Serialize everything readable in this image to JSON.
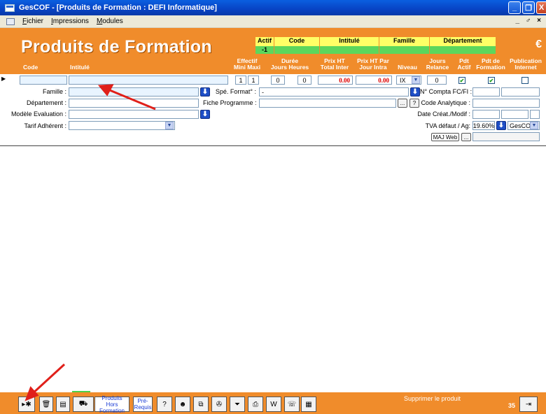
{
  "window": {
    "title": "GesCOF - [Produits de Formation  : DEFI Informatique]",
    "minimize": "_",
    "restore": "❐",
    "close": "X"
  },
  "menu": {
    "items": [
      "Fichier",
      "Impressions",
      "Modules"
    ],
    "mdi_controls": "_ ♂ ×"
  },
  "header": {
    "title": "Produits de Formation",
    "currency": "€",
    "filters": [
      {
        "label": "Actif",
        "value": "-1"
      },
      {
        "label": "Code",
        "value": ""
      },
      {
        "label": "Intitulé",
        "value": ""
      },
      {
        "label": "Famille",
        "value": ""
      },
      {
        "label": "Département",
        "value": ""
      }
    ],
    "columns": {
      "code": "Code",
      "intitule": "Intitulé",
      "effectif": "Effectif",
      "mini_maxi": "Mini Maxi",
      "duree": "Durée",
      "jours_heures": "Jours Heures",
      "prix_ht": "Prix HT",
      "total_inter": "Total Inter",
      "prix_ht_par": "Prix HT Par",
      "jour_intra": "Jour Intra",
      "niveau": "Niveau",
      "jours": "Jours",
      "relance": "Relance",
      "pdt": "Pdt",
      "actif": "Actif",
      "pdt_de": "Pdt de",
      "formation": "Formation",
      "publication": "Publication",
      "internet": "Internet"
    }
  },
  "row": {
    "code": "",
    "intitule": "",
    "mini": "1",
    "maxi": "1",
    "jours": "0",
    "heures": "0",
    "prix_inter": "0.00",
    "prix_intra": "0.00",
    "niveau": "IX",
    "relance": "0",
    "pdt_actif": "✔",
    "pdt_formation": "✔",
    "publication": ""
  },
  "form": {
    "famille_label": "Famille :",
    "departement_label": "Département :",
    "modele_label": "Modèle Evaluation :",
    "tarif_label": "Tarif Adhérent :",
    "spe_format_label": "Spé. Format° :",
    "spe_format_value": "-",
    "fiche_label": "Fiche Programme :",
    "compta_label": "N° Compta FC/FI :",
    "analytique_label": "Code Analytique :",
    "date_label": "Date Créat./Modif :",
    "tva_label": "TVA défaut / Ag:",
    "tva_value": "19.60%",
    "agence_value": "GesCO",
    "maj_web": "MAJ Web",
    "ellipsis": "...",
    "help": "?"
  },
  "toolbar": {
    "produits_hors_formation": "Produits Hors Formation",
    "pre_requis": "Pré-Requis",
    "status": "Supprimer le produit",
    "count": "35"
  }
}
